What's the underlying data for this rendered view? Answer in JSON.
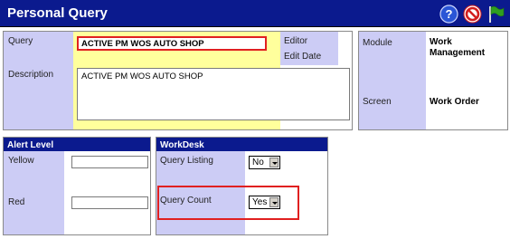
{
  "header": {
    "title": "Personal Query",
    "icons": [
      "help-icon",
      "cancel-icon",
      "flag-icon"
    ],
    "colors": {
      "bar": "#0b1a8e",
      "help": "#2a55d6",
      "cancel": "#d21f1f",
      "flag": "#2f9e20"
    }
  },
  "query": {
    "query_label": "Query",
    "query_value": "ACTIVE PM WOS AUTO SHOP",
    "description_label": "Description",
    "description_value": "ACTIVE PM WOS AUTO SHOP",
    "editor_label": "Editor",
    "edit_date_label": "Edit Date"
  },
  "module": {
    "module_label": "Module",
    "module_value": "Work Management",
    "screen_label": "Screen",
    "screen_value": "Work Order"
  },
  "alert_level": {
    "header": "Alert Level",
    "yellow_label": "Yellow",
    "red_label": "Red"
  },
  "workdesk": {
    "header": "WorkDesk",
    "query_listing_label": "Query Listing",
    "query_listing_value": "No",
    "query_count_label": "Query Count",
    "query_count_value": "Yes"
  },
  "highlight_color": "#e02020"
}
